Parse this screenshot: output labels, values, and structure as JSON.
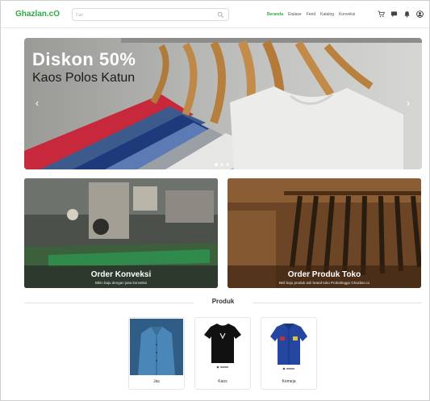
{
  "brand": {
    "name": "Ghazlan.cO"
  },
  "search": {
    "placeholder": "Cari"
  },
  "nav": {
    "links": [
      "Beranda",
      "Etalase",
      "Feed",
      "Katalog",
      "Konveksi"
    ],
    "active": "Beranda",
    "icons": [
      "cart-icon",
      "chat-icon",
      "bell-icon",
      "user-icon"
    ]
  },
  "hero": {
    "title": "Diskon 50%",
    "subtitle": "Kaos Polos Katun",
    "slides": 3,
    "active_slide": 1
  },
  "promos": [
    {
      "title": "Order Konveksi",
      "desc": "Bikin baju dengan jasa konveksi"
    },
    {
      "title": "Order Produk Toko",
      "desc": "Beli baju produk asli brand toko Probolinggo Ghazlan.co"
    }
  ],
  "section": {
    "title": "Produk"
  },
  "products": [
    {
      "name": "Jas"
    },
    {
      "name": "Kaos"
    },
    {
      "name": "Kemeja"
    }
  ],
  "colors": {
    "brand": "#2eaa45"
  }
}
